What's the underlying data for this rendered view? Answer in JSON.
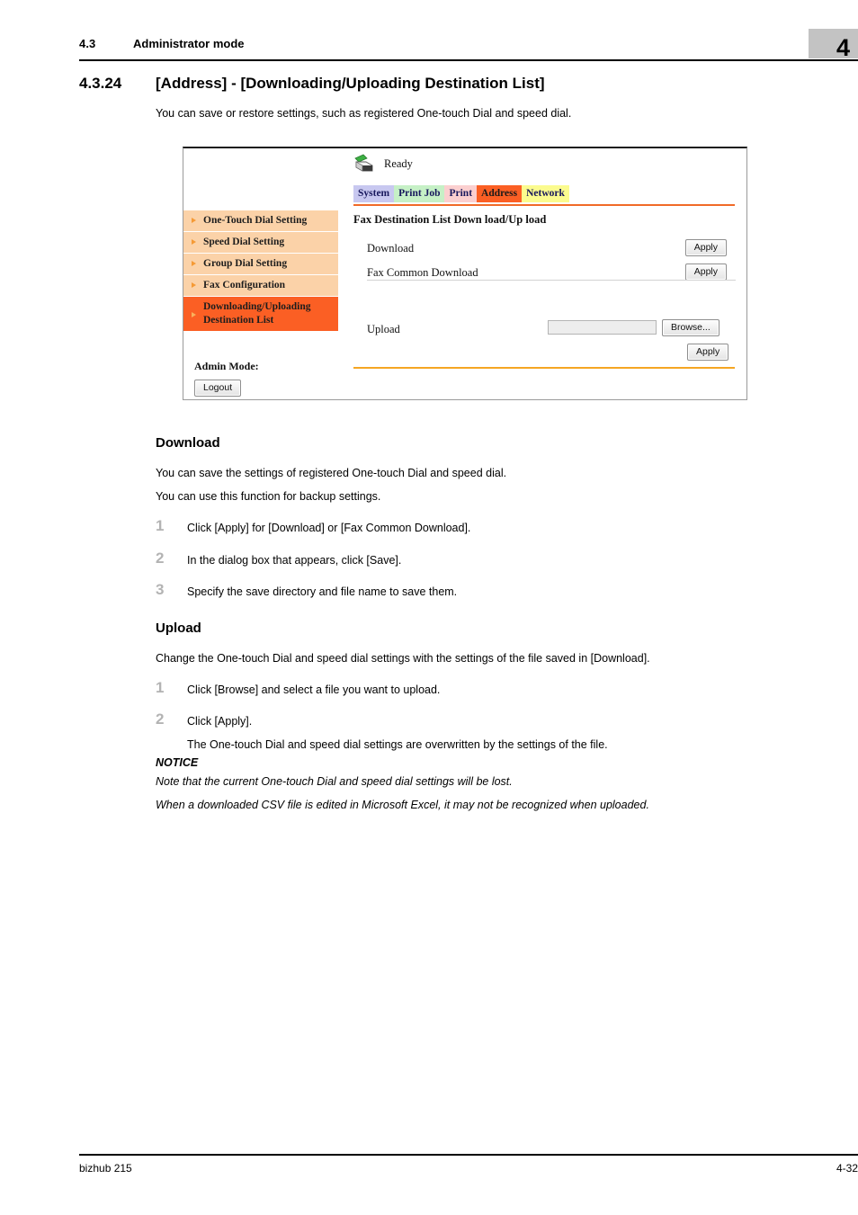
{
  "header": {
    "section_number": "4.3",
    "section_title": "Administrator mode",
    "chapter": "4"
  },
  "section": {
    "number": "4.3.24",
    "title": "[Address] - [Downloading/Uploading Destination List]",
    "intro": "You can save or restore settings, such as registered One-touch Dial and speed dial."
  },
  "screenshot": {
    "status": {
      "icon": "printer-icon",
      "text": "Ready"
    },
    "tabs": [
      {
        "label": "System",
        "bg": "#c8c8f0",
        "active": false
      },
      {
        "label": "Print Job",
        "bg": "#c6f0c6",
        "active": false
      },
      {
        "label": "Print",
        "bg": "#fbcfcf",
        "active": false
      },
      {
        "label": "Address",
        "bg": "#fb5f24",
        "active": true
      },
      {
        "label": "Network",
        "bg": "#fbfb8e",
        "active": false
      }
    ],
    "sidebar": {
      "items": [
        {
          "label": "One-Touch Dial Setting",
          "selected": false
        },
        {
          "label": "Speed Dial Setting",
          "selected": false
        },
        {
          "label": "Group Dial Setting",
          "selected": false
        },
        {
          "label": "Fax Configuration",
          "selected": false
        },
        {
          "label": "Downloading/Uploading Destination List",
          "selected": true
        }
      ],
      "admin_label": "Admin Mode:",
      "logout_label": "Logout"
    },
    "panel": {
      "title": "Fax Destination List Down load/Up load",
      "rows": [
        {
          "label": "Download",
          "button": "Apply"
        },
        {
          "label": "Fax Common Download",
          "button": "Apply"
        }
      ],
      "upload": {
        "label": "Upload",
        "file_value": "",
        "browse_label": "Browse...",
        "apply_label": "Apply"
      }
    },
    "colors": {
      "accent_orange": "#fb5f24",
      "tab_rule": "#f06a28",
      "bottom_rule": "#f5a623",
      "sidebar_item": "#fbd2a8"
    }
  },
  "download_section": {
    "heading": "Download",
    "paragraphs": [
      "You can save the settings of registered One-touch Dial and speed dial.",
      "You can use this function for backup settings."
    ],
    "steps": [
      {
        "n": "1",
        "text": "Click [Apply] for [Download] or [Fax Common Download]."
      },
      {
        "n": "2",
        "text": "In the dialog box that appears, click [Save]."
      },
      {
        "n": "3",
        "text": "Specify the save directory and file name to save them."
      }
    ]
  },
  "upload_section": {
    "heading": "Upload",
    "paragraph": "Change the One-touch Dial and speed dial settings with the settings of the file saved in [Download].",
    "steps": [
      {
        "n": "1",
        "text": "Click [Browse] and select a file you want to upload."
      },
      {
        "n": "2",
        "text": "Click [Apply]."
      }
    ],
    "step2_note": "The One-touch Dial and speed dial settings are overwritten by the settings of the file.",
    "notice_title": "NOTICE",
    "notice_lines": [
      "Note that the current One-touch Dial and speed dial settings will be lost.",
      "When a downloaded CSV file is edited in Microsoft Excel, it may not be recognized when uploaded."
    ]
  },
  "footer": {
    "product": "bizhub 215",
    "page": "4-32"
  }
}
